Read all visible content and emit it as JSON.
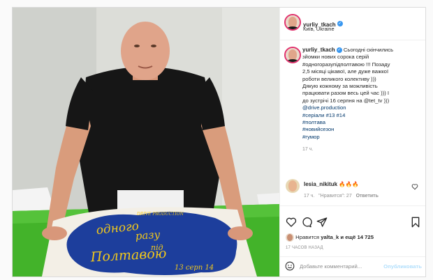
{
  "post": {
    "author": "yurliy_tkach",
    "location": "Київ, Ukraine"
  },
  "caption": {
    "author": "yurliy_tkach",
    "lines": [
      {
        "text": "Сьогодні скінчились",
        "is_tag": false
      },
      {
        "text": "зйомки нових сорока серій",
        "is_tag": false
      },
      {
        "text": "#одногоразупідполтавою !!! Позаду",
        "is_tag": false
      },
      {
        "text": "2,5 місяці цікавої, але дуже важкої",
        "is_tag": false
      },
      {
        "text": "роботи великого колективу )))",
        "is_tag": false
      },
      {
        "text": "Дякую кожному за можливість",
        "is_tag": false
      },
      {
        "text": "працювати разом весь цей час ))) І",
        "is_tag": false
      },
      {
        "text": "до зустрічі 16 серпня на @tet_tv )))",
        "is_tag": false
      },
      {
        "text": "@drive.production",
        "is_tag": true
      },
      {
        "text": "#серіали #13 #14",
        "is_tag": true
      },
      {
        "text": "#полтава",
        "is_tag": true
      },
      {
        "text": "#новийсезон",
        "is_tag": true
      },
      {
        "text": "#гумор",
        "is_tag": true
      }
    ],
    "time": "17 ч."
  },
  "comment": {
    "author": "lesia_nikituk",
    "emoji": "🔥🔥🔥",
    "time": "17 ч.",
    "likes": "\"Нравится\": 27",
    "reply": "Ответить"
  },
  "likes": {
    "prefix": "Нравится",
    "user": "yalta_k",
    "suffix": "и ещё 14 725"
  },
  "timestamp": "17 ЧАСОВ НАЗАД",
  "add_comment": {
    "placeholder": "Добавьте комментарий...",
    "post_label": "Опубликовать"
  },
  "cake": {
    "brand_prefix": "DRIVE",
    "brand": "PRODUCTION",
    "title_line1": "одного",
    "title_line2": "разу",
    "title_line3": "під",
    "title_line4": "Полтавою",
    "date": "13 серп 14"
  },
  "colors": {
    "link": "#00376b",
    "verified": "#3897f0",
    "post_button_disabled": "#b2dffc",
    "cake_blue": "#1d3e9c",
    "cake_yellow": "#f2c81b",
    "table_green": "#43b32a"
  },
  "icons": [
    "heart-icon",
    "comment-icon",
    "share-icon",
    "bookmark-icon",
    "emoji-icon",
    "verified-icon"
  ]
}
